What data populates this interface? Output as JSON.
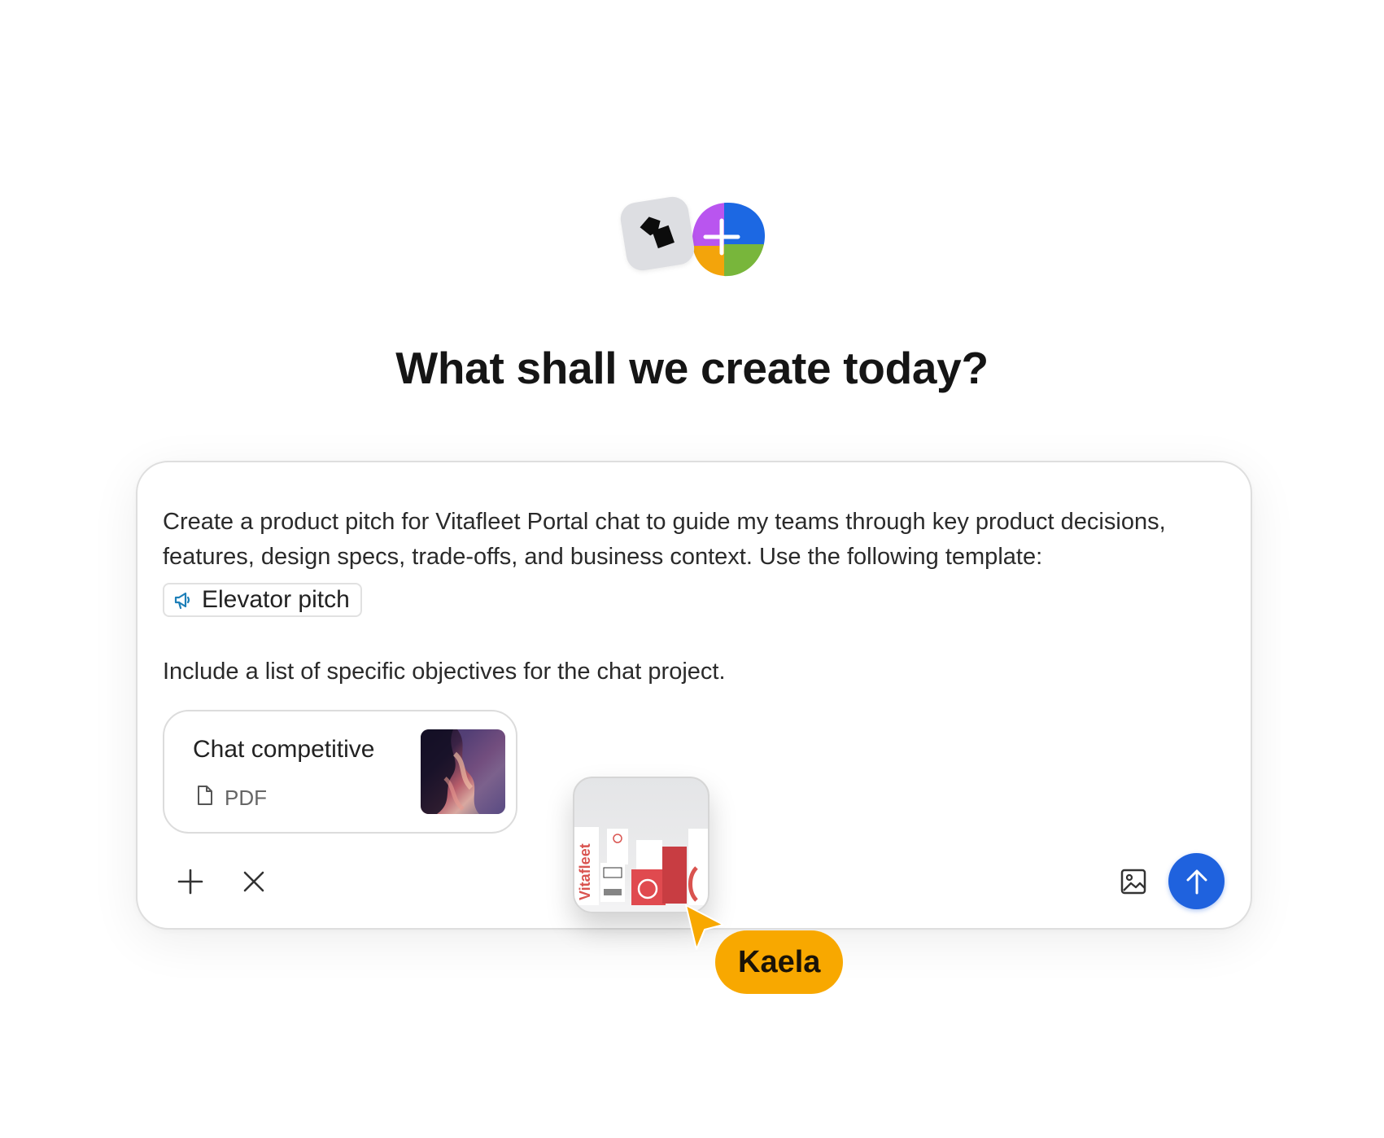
{
  "header": {
    "title": "What shall we create today?"
  },
  "composer": {
    "prompt_text": "Create a product pitch for Vitafleet Portal chat to guide my teams through key product decisions, features, design specs, trade-offs, and business context. Use the following template:",
    "template_chip": {
      "icon": "megaphone-icon",
      "label": "Elevator pitch"
    },
    "objective_text": "Include a list of specific objectives for the chat project.",
    "attachment": {
      "title": "Chat competitive",
      "type_label": "PDF",
      "type_icon": "document-icon"
    },
    "toolbar": {
      "add_icon": "plus-icon",
      "close_icon": "close-icon",
      "image_icon": "image-icon",
      "send_icon": "arrow-up-icon"
    }
  },
  "drag_preview": {
    "brand_text": "Vitafleet"
  },
  "collaborator": {
    "name": "Kaela",
    "color": "#f8a800"
  },
  "colors": {
    "send_button": "#1f62de",
    "chip_icon": "#1d7fb8",
    "title": "#151515"
  }
}
